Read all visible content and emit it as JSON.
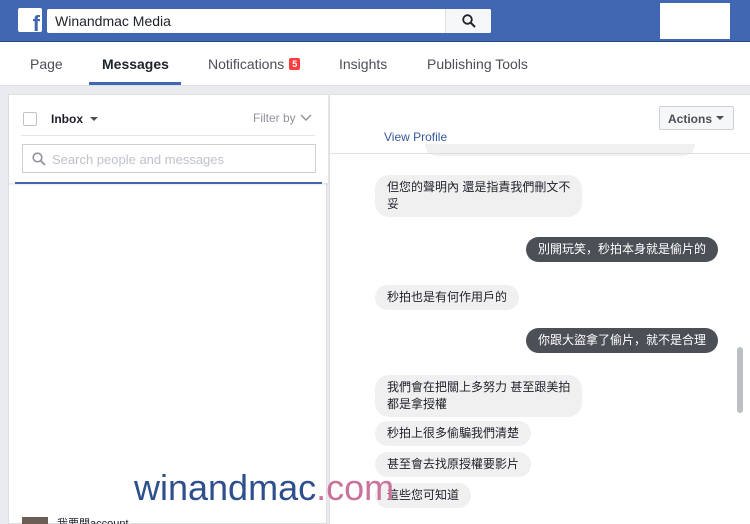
{
  "topbar": {
    "search_value": "Winandmac Media"
  },
  "nav": {
    "tabs": [
      {
        "label": "Page"
      },
      {
        "label": "Messages"
      },
      {
        "label": "Notifications",
        "badge": "5"
      },
      {
        "label": "Insights"
      },
      {
        "label": "Publishing Tools"
      }
    ]
  },
  "inbox": {
    "label": "Inbox",
    "filter_label": "Filter by",
    "search_placeholder": "Search people and messages",
    "thread_name": "我要開account"
  },
  "conversation": {
    "actions_label": "Actions",
    "view_profile": "View Profile",
    "messages": [
      {
        "dir": "in",
        "text": "但您的聲明內 還是指責我們刪文不\n妥"
      },
      {
        "dir": "out",
        "text": "別開玩笑，秒拍本身就是偷片的"
      },
      {
        "dir": "in",
        "text": "秒拍也是有何作用戶的"
      },
      {
        "dir": "out",
        "text": "你跟大盜拿了偷片，就不是合理"
      },
      {
        "dir": "in",
        "text": "我們會在把關上多努力 甚至跟美拍\n都是拿授權"
      },
      {
        "dir": "in",
        "text": "秒拍上很多偷騙我們清楚"
      },
      {
        "dir": "in",
        "text": "甚至會去找原授權要影片"
      },
      {
        "dir": "in",
        "text": "這些您可知道"
      }
    ]
  },
  "watermark": {
    "part1": "winandmac",
    "part2": ".com"
  },
  "colors": {
    "brand_blue": "#4267b2",
    "outgoing_bubble": "#4b4f56",
    "incoming_bubble": "#f1f0f0",
    "badge_red": "#fa3e3e"
  }
}
